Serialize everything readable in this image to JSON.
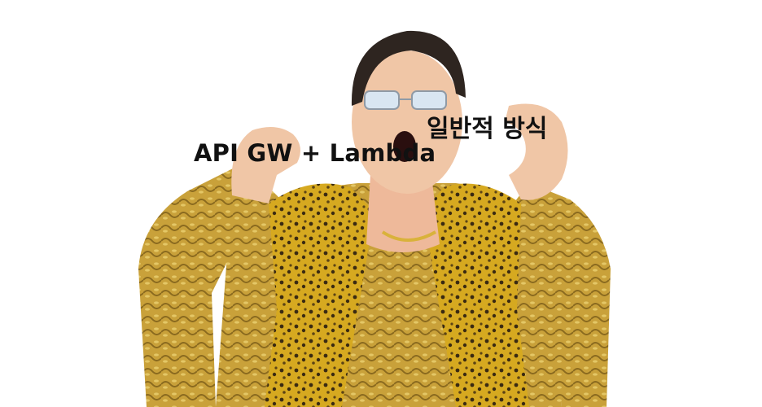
{
  "captions": {
    "left": "API GW + Lambda",
    "right": "일반적 방식"
  },
  "colors": {
    "background": "#ffffff",
    "outfit_gold": "#c9a13a",
    "leopard_scarf": "#d6a920",
    "skin": "#f0c6a6",
    "hair": "#2e2520",
    "text": "#111111"
  },
  "icons": {
    "figure": "performer-figure-illustration"
  }
}
